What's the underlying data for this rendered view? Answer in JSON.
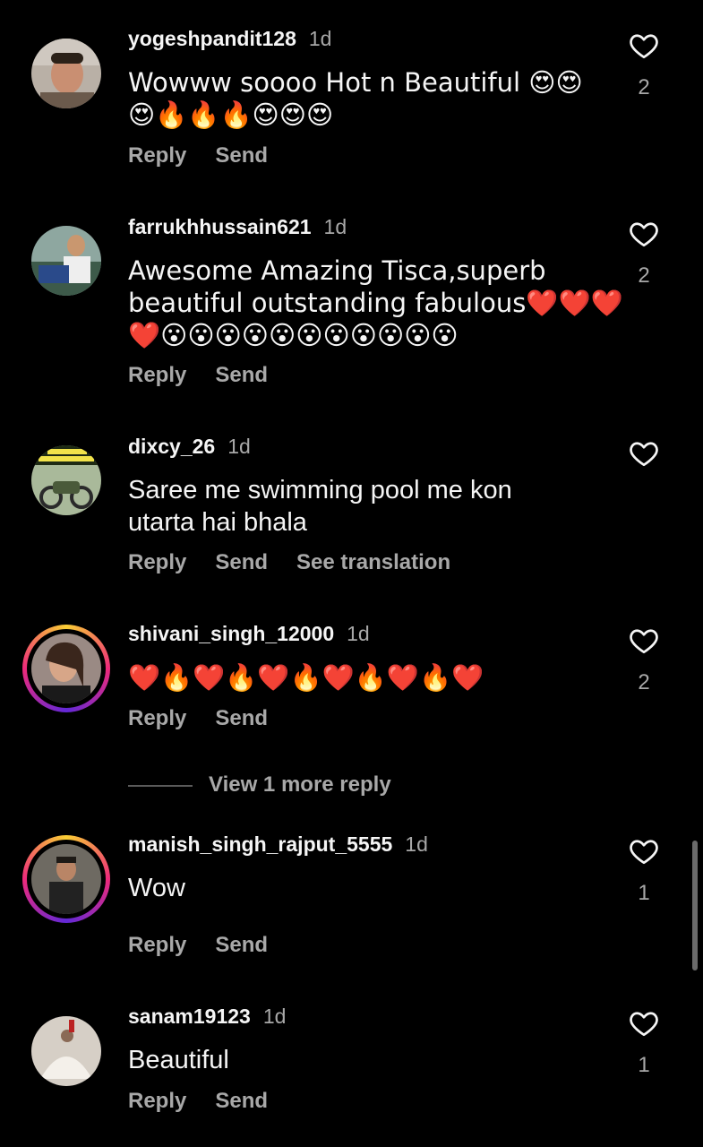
{
  "comments": [
    {
      "username": "yogeshpandit128",
      "time": "1d",
      "text": "Wowww soooo Hot n Beautiful 😍😍\n😍🔥🔥🔥😍😍😍",
      "likes": "2",
      "actions": {
        "reply": "Reply",
        "send": "Send"
      }
    },
    {
      "username": "farrukhhussain621",
      "time": "1d",
      "text": "Awesome Amazing Tisca,superb\nbeautiful outstanding fabulous❤️❤️❤️\n❤️😮😮😮😮😮😮😮😮😮😮😮",
      "likes": "2",
      "actions": {
        "reply": "Reply",
        "send": "Send"
      }
    },
    {
      "username": "dixcy_26",
      "time": "1d",
      "text": "Saree me swimming pool me kon\nutarta hai bhala",
      "likes": "",
      "actions": {
        "reply": "Reply",
        "send": "Send",
        "translate": "See translation"
      }
    },
    {
      "username": "shivani_singh_12000",
      "time": "1d",
      "text": "❤️🔥❤️🔥❤️🔥❤️🔥❤️🔥❤️",
      "likes": "2",
      "actions": {
        "reply": "Reply",
        "send": "Send"
      }
    },
    {
      "username": "manish_singh_rajput_5555",
      "time": "1d",
      "text": "Wow",
      "likes": "1",
      "actions": {
        "reply": "Reply",
        "send": "Send"
      }
    },
    {
      "username": "sanam19123",
      "time": "1d",
      "text": "Beautiful",
      "likes": "1",
      "actions": {
        "reply": "Reply",
        "send": "Send"
      }
    }
  ],
  "view_more": "View 1 more reply",
  "colors": {
    "background": "#000000",
    "text": "#f5f5f5",
    "secondary": "#a8a8a8"
  }
}
